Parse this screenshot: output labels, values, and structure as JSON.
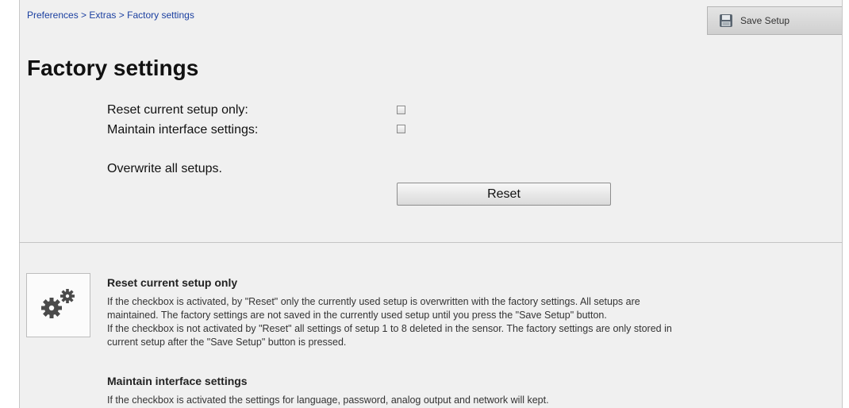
{
  "breadcrumb": {
    "items": [
      "Preferences",
      "Extras",
      "Factory settings"
    ],
    "separator": ">"
  },
  "toolbar": {
    "save_label": "Save Setup",
    "save_icon": "floppy-disk-icon"
  },
  "page": {
    "title": "Factory settings"
  },
  "options": {
    "reset_current_label": "Reset current setup only:",
    "reset_current_checked": false,
    "maintain_interface_label": "Maintain interface settings:",
    "maintain_interface_checked": false,
    "overwrite_text": "Overwrite all setups.",
    "reset_button_label": "Reset"
  },
  "help": {
    "icon": "gears-icon",
    "section1_title": "Reset current setup only",
    "section1_lines": [
      "If the checkbox is activated, by \"Reset\" only the currently used setup is overwritten with the factory settings. All setups are",
      "maintained. The factory settings are not saved in the currently used setup until you press the \"Save Setup\" button.",
      "If the checkbox is not activated by \"Reset\" all settings of setup 1 to 8 deleted in the sensor. The factory settings are only stored in",
      "current setup after the \"Save Setup\" button is pressed."
    ],
    "section2_title": "Maintain interface settings",
    "section2_text": "If the checkbox is activated the settings for language, password, analog output and network will kept."
  },
  "colors": {
    "link": "#1a3fa0",
    "panel_bg": "#f0f0f0"
  }
}
